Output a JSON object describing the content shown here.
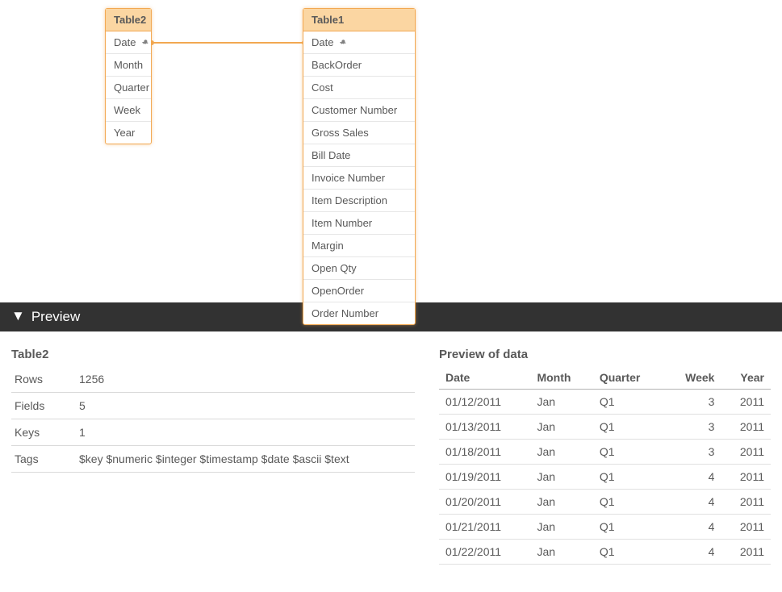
{
  "canvas": {
    "table2": {
      "title": "Table2",
      "fields": [
        {
          "label": "Date",
          "key": true
        },
        {
          "label": "Month",
          "key": false
        },
        {
          "label": "Quarter",
          "key": false
        },
        {
          "label": "Week",
          "key": false
        },
        {
          "label": "Year",
          "key": false
        }
      ]
    },
    "table1": {
      "title": "Table1",
      "fields": [
        {
          "label": "Date",
          "key": true
        },
        {
          "label": "BackOrder",
          "key": false
        },
        {
          "label": "Cost",
          "key": false
        },
        {
          "label": "Customer Number",
          "key": false
        },
        {
          "label": "Gross Sales",
          "key": false
        },
        {
          "label": "Bill Date",
          "key": false
        },
        {
          "label": "Invoice Number",
          "key": false
        },
        {
          "label": "Item Description",
          "key": false
        },
        {
          "label": "Item Number",
          "key": false
        },
        {
          "label": "Margin",
          "key": false
        },
        {
          "label": "Open Qty",
          "key": false
        },
        {
          "label": "OpenOrder",
          "key": false
        },
        {
          "label": "Order Number",
          "key": false
        }
      ]
    }
  },
  "previewBar": {
    "label": "Preview"
  },
  "meta": {
    "title": "Table2",
    "rows_label": "Rows",
    "rows_value": "1256",
    "fields_label": "Fields",
    "fields_value": "5",
    "keys_label": "Keys",
    "keys_value": "1",
    "tags_label": "Tags",
    "tags_value": "$key $numeric $integer $timestamp $date $ascii $text"
  },
  "preview": {
    "title": "Preview of data",
    "columns": [
      "Date",
      "Month",
      "Quarter",
      "Week",
      "Year"
    ],
    "rows": [
      [
        "01/12/2011",
        "Jan",
        "Q1",
        "3",
        "2011"
      ],
      [
        "01/13/2011",
        "Jan",
        "Q1",
        "3",
        "2011"
      ],
      [
        "01/18/2011",
        "Jan",
        "Q1",
        "3",
        "2011"
      ],
      [
        "01/19/2011",
        "Jan",
        "Q1",
        "4",
        "2011"
      ],
      [
        "01/20/2011",
        "Jan",
        "Q1",
        "4",
        "2011"
      ],
      [
        "01/21/2011",
        "Jan",
        "Q1",
        "4",
        "2011"
      ],
      [
        "01/22/2011",
        "Jan",
        "Q1",
        "4",
        "2011"
      ]
    ]
  }
}
